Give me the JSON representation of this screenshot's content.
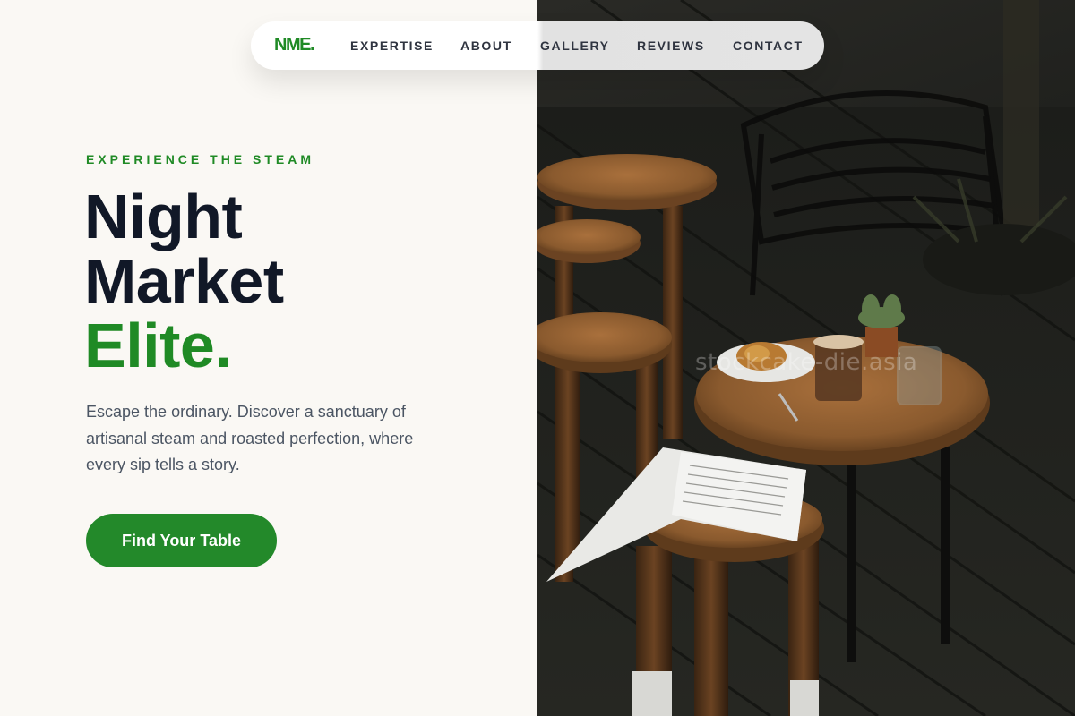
{
  "brand": {
    "logo": "NME."
  },
  "nav": {
    "items": [
      {
        "label": "EXPERTISE"
      },
      {
        "label": "ABOUT"
      },
      {
        "label": "GALLERY"
      },
      {
        "label": "REVIEWS"
      },
      {
        "label": "CONTACT"
      }
    ]
  },
  "hero": {
    "eyebrow": "EXPERIENCE THE STEAM",
    "title_line1": "Night",
    "title_line2": "Market",
    "title_accent": "Elite.",
    "description": "Escape the ordinary. Discover a sanctuary of artisanal steam and roasted perfection, where every sip tells a story.",
    "cta_label": "Find Your Table"
  },
  "photo": {
    "watermark": "stockcake-die.asia"
  },
  "colors": {
    "accent": "#1f8a25",
    "heading": "#111827",
    "body_text": "#4b5563",
    "background": "#faf8f4"
  }
}
